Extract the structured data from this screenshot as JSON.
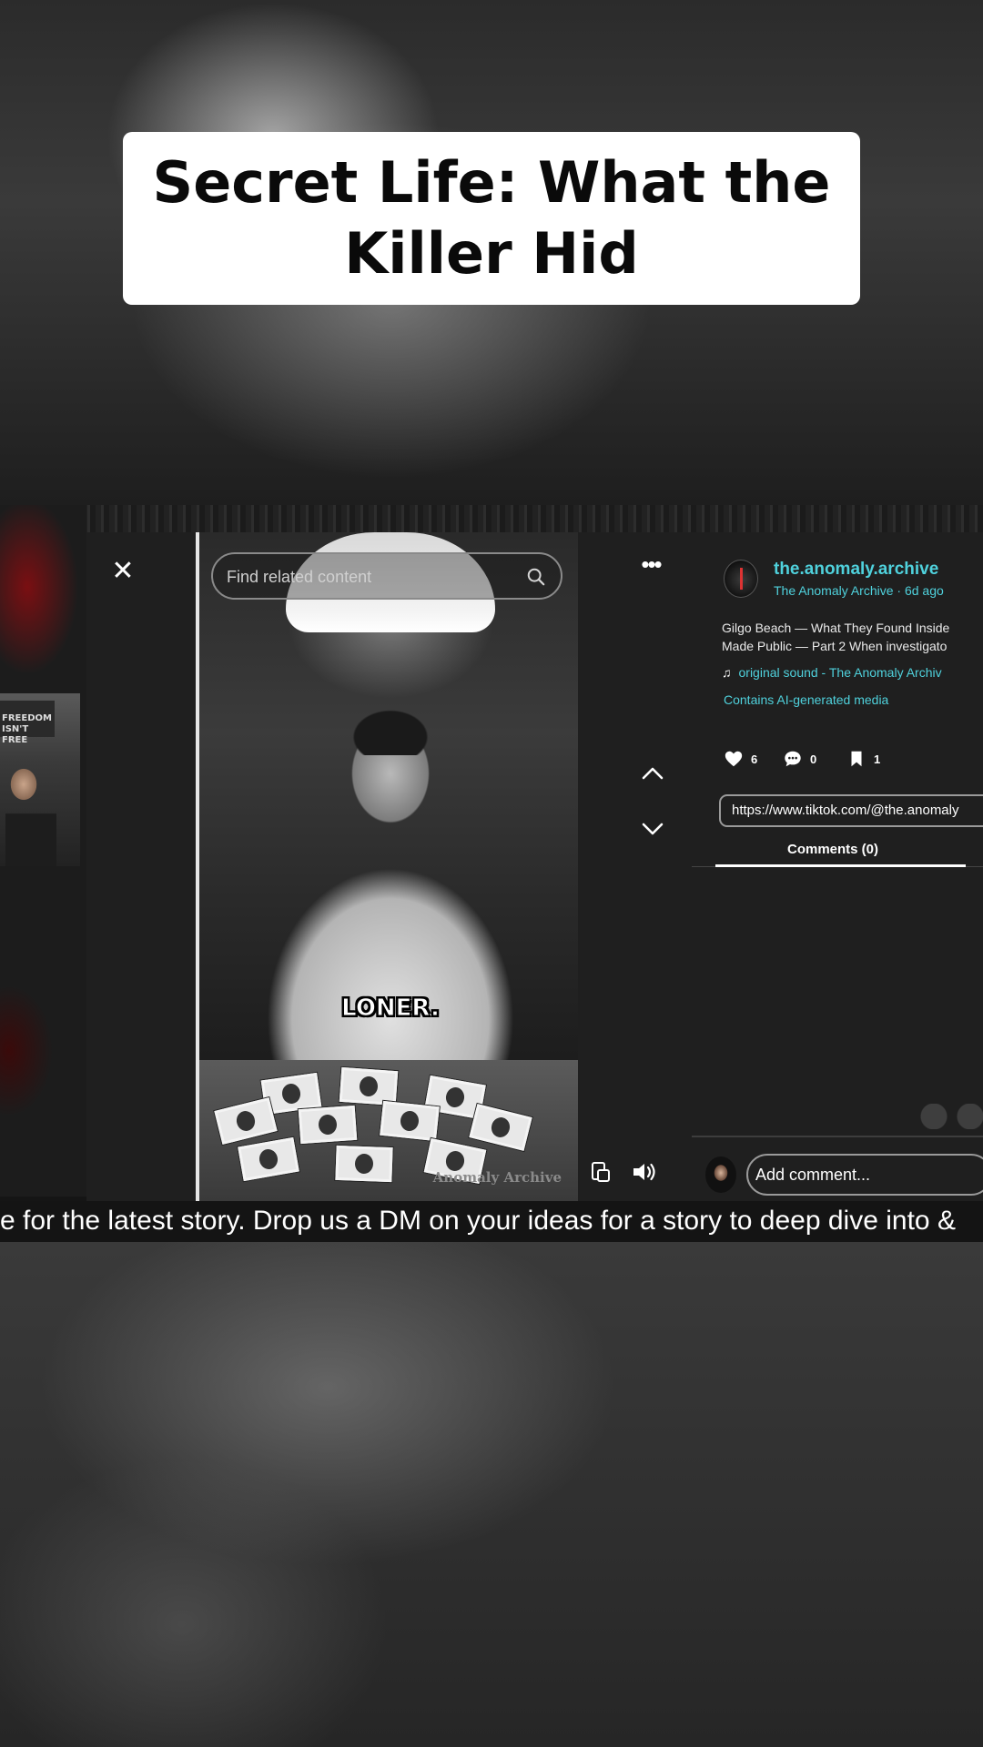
{
  "title_card": {
    "text": "Secret Life: What the Killer Hid"
  },
  "stream_overlay": {
    "cam_sign": "FREEDOM ISN'T FREE"
  },
  "player": {
    "close_label": "✕",
    "search": {
      "placeholder": "Find related content"
    },
    "subtitle": "LONER.",
    "watermark": "Anomaly Archive",
    "more_label": "•••"
  },
  "panel": {
    "author_name": "the.anomaly.archive",
    "author_meta": "The Anomaly Archive · 6d ago",
    "description_line1": "Gilgo Beach — What They Found Inside",
    "description_line2": "Made Public — Part 2 When investigato",
    "sound": "original sound - The Anomaly Archiv",
    "ai_label": "Contains AI-generated media",
    "stats": {
      "likes": "6",
      "comments": "0",
      "saves": "1"
    },
    "url": "https://www.tiktok.com/@the.anomaly",
    "comments_tab": "Comments (0)",
    "comment_placeholder": "Add comment..."
  },
  "ticker": {
    "text": "e for the latest story. Drop us a DM on your ideas for a story to deep dive into &"
  },
  "colors": {
    "accent": "#4fd1dc",
    "panel_bg": "#1f1f1f",
    "card_bg": "#ffffff"
  },
  "icons": [
    "close-icon",
    "search-icon",
    "more-icon",
    "chevron-up-icon",
    "chevron-down-icon",
    "heart-icon",
    "comment-icon",
    "bookmark-icon",
    "music-note-icon",
    "transcript-icon",
    "volume-icon"
  ]
}
